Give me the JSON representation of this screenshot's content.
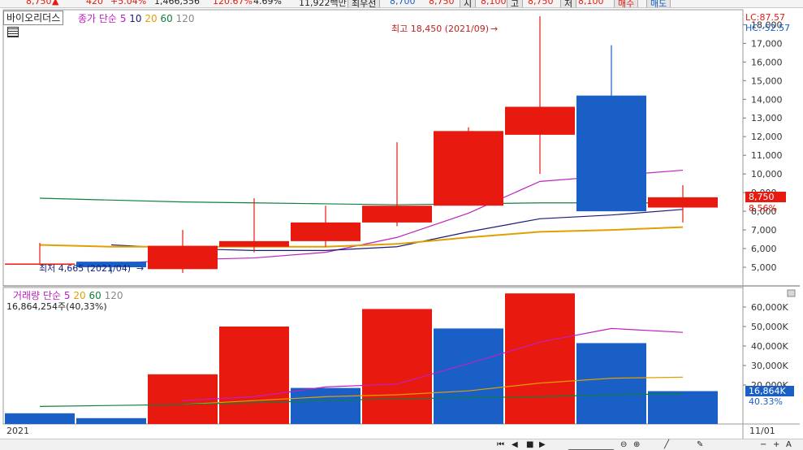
{
  "topbar": {
    "price": "8,750",
    "change": "420",
    "rate": "+5.04%",
    "volume": "1,466,556",
    "volume_rate": "120.67%",
    "turnover": "4.69%",
    "amount": "11,922백만",
    "label_sosu": "최우선",
    "bid1": "8,700",
    "ask1": "8,750",
    "label_si": "시",
    "open": "8,100",
    "label_go": "고",
    "high": "8,750",
    "label_jeo": "저",
    "low": "8,100",
    "buy_label": "매수",
    "sell_label": "매도"
  },
  "header": {
    "stock_name": "바이오리더스",
    "ma_label": "종가 단순",
    "ma_periods": [
      "5",
      "10",
      "20",
      "60",
      "120"
    ],
    "lc_label": "LC:87.57",
    "hc_label": "HC:-52.57"
  },
  "volume_panel": {
    "title": "거래량",
    "ma_label": "단순",
    "ma_periods": [
      "5",
      "20",
      "60",
      "120"
    ],
    "current_text": "16,864,254주(40,33%)",
    "badge_value": "16,864K",
    "badge_pct": "40.33%"
  },
  "annotations": {
    "high_text": "최고 18,450 (2021/09)",
    "low_text": "최저 4,665 (2021/04)",
    "price_badge": "8,750",
    "pct_badge": "8.56%"
  },
  "axis": {
    "x_left": "2021",
    "x_right": "11/01"
  },
  "colors": {
    "up": "#e8190f",
    "down": "#1a5fc6",
    "ma5": "#c020c0",
    "ma10": "#1a1a7a",
    "ma20": "#e0a000",
    "ma60": "#108040",
    "ma120": "#888888",
    "badge_blue": "#1a5fc6",
    "badge_red": "#e8190f"
  },
  "chart_data": [
    {
      "type": "candlestick",
      "title": "바이오리더스",
      "ylim": [
        4000,
        18800
      ],
      "yticks": [
        5000,
        6000,
        7000,
        8000,
        9000,
        10000,
        11000,
        12000,
        13000,
        14000,
        15000,
        16000,
        17000,
        18000
      ],
      "ytick_labels": [
        "5,000",
        "6,000",
        "7,000",
        "8,000",
        "9,000",
        "10,000",
        "11,000",
        "12,000",
        "13,000",
        "14,000",
        "15,000",
        "16,000",
        "17,000",
        "18,000"
      ],
      "candles": [
        {
          "open": 5200,
          "close": 5200,
          "high": 6300,
          "low": 5200
        },
        {
          "open": 5300,
          "close": 5000,
          "high": 5300,
          "low": 4665
        },
        {
          "open": 4900,
          "close": 6150,
          "high": 7000,
          "low": 4700
        },
        {
          "open": 6100,
          "close": 6400,
          "high": 8700,
          "low": 5800
        },
        {
          "open": 6400,
          "close": 7400,
          "high": 8300,
          "low": 6100
        },
        {
          "open": 7400,
          "close": 8300,
          "high": 11700,
          "low": 7200
        },
        {
          "open": 8300,
          "close": 12300,
          "high": 12500,
          "low": 8300
        },
        {
          "open": 12100,
          "close": 13600,
          "high": 18450,
          "low": 10000
        },
        {
          "open": 14200,
          "close": 8000,
          "high": 16900,
          "low": 8000
        },
        {
          "open": 8200,
          "close": 8750,
          "high": 9400,
          "low": 7400
        }
      ],
      "series": [
        {
          "name": "5",
          "values": [
            null,
            5200,
            5400,
            5500,
            5800,
            6600,
            7900,
            9600,
            9900,
            10200
          ]
        },
        {
          "name": "10",
          "values": [
            null,
            6200,
            6000,
            5900,
            5900,
            6100,
            6900,
            7600,
            7800,
            8100
          ]
        },
        {
          "name": "20",
          "values": [
            6200,
            6100,
            6100,
            6100,
            6100,
            6250,
            6600,
            6900,
            7000,
            7150
          ]
        },
        {
          "name": "60",
          "values": [
            8700,
            8600,
            8500,
            8450,
            8400,
            8350,
            8400,
            8450,
            8450,
            8450
          ]
        },
        {
          "name": "120",
          "values": [
            null,
            null,
            null,
            null,
            null,
            null,
            null,
            null,
            null,
            null
          ]
        }
      ]
    },
    {
      "type": "bar",
      "title": "거래량",
      "ylim": [
        0,
        70000
      ],
      "yticks": [
        20000,
        30000,
        40000,
        50000,
        60000
      ],
      "ytick_labels": [
        "20,000K",
        "30,000K",
        "40,000K",
        "50,000K",
        "60,000K"
      ],
      "values": [
        5500,
        3000,
        25500,
        50000,
        18500,
        59000,
        49000,
        67000,
        41500,
        16864
      ],
      "directions": [
        "down",
        "down",
        "up",
        "up",
        "down",
        "up",
        "down",
        "up",
        "down",
        "down"
      ],
      "series": [
        {
          "name": "5",
          "values": [
            null,
            null,
            12000,
            14000,
            19000,
            20500,
            31000,
            42000,
            49000,
            47000
          ]
        },
        {
          "name": "20",
          "values": [
            null,
            null,
            10000,
            12000,
            14000,
            15000,
            17000,
            21000,
            23500,
            24000
          ]
        },
        {
          "name": "60",
          "values": [
            9000,
            9500,
            10000,
            11000,
            12000,
            13000,
            13500,
            14000,
            15000,
            15500
          ]
        }
      ]
    }
  ]
}
